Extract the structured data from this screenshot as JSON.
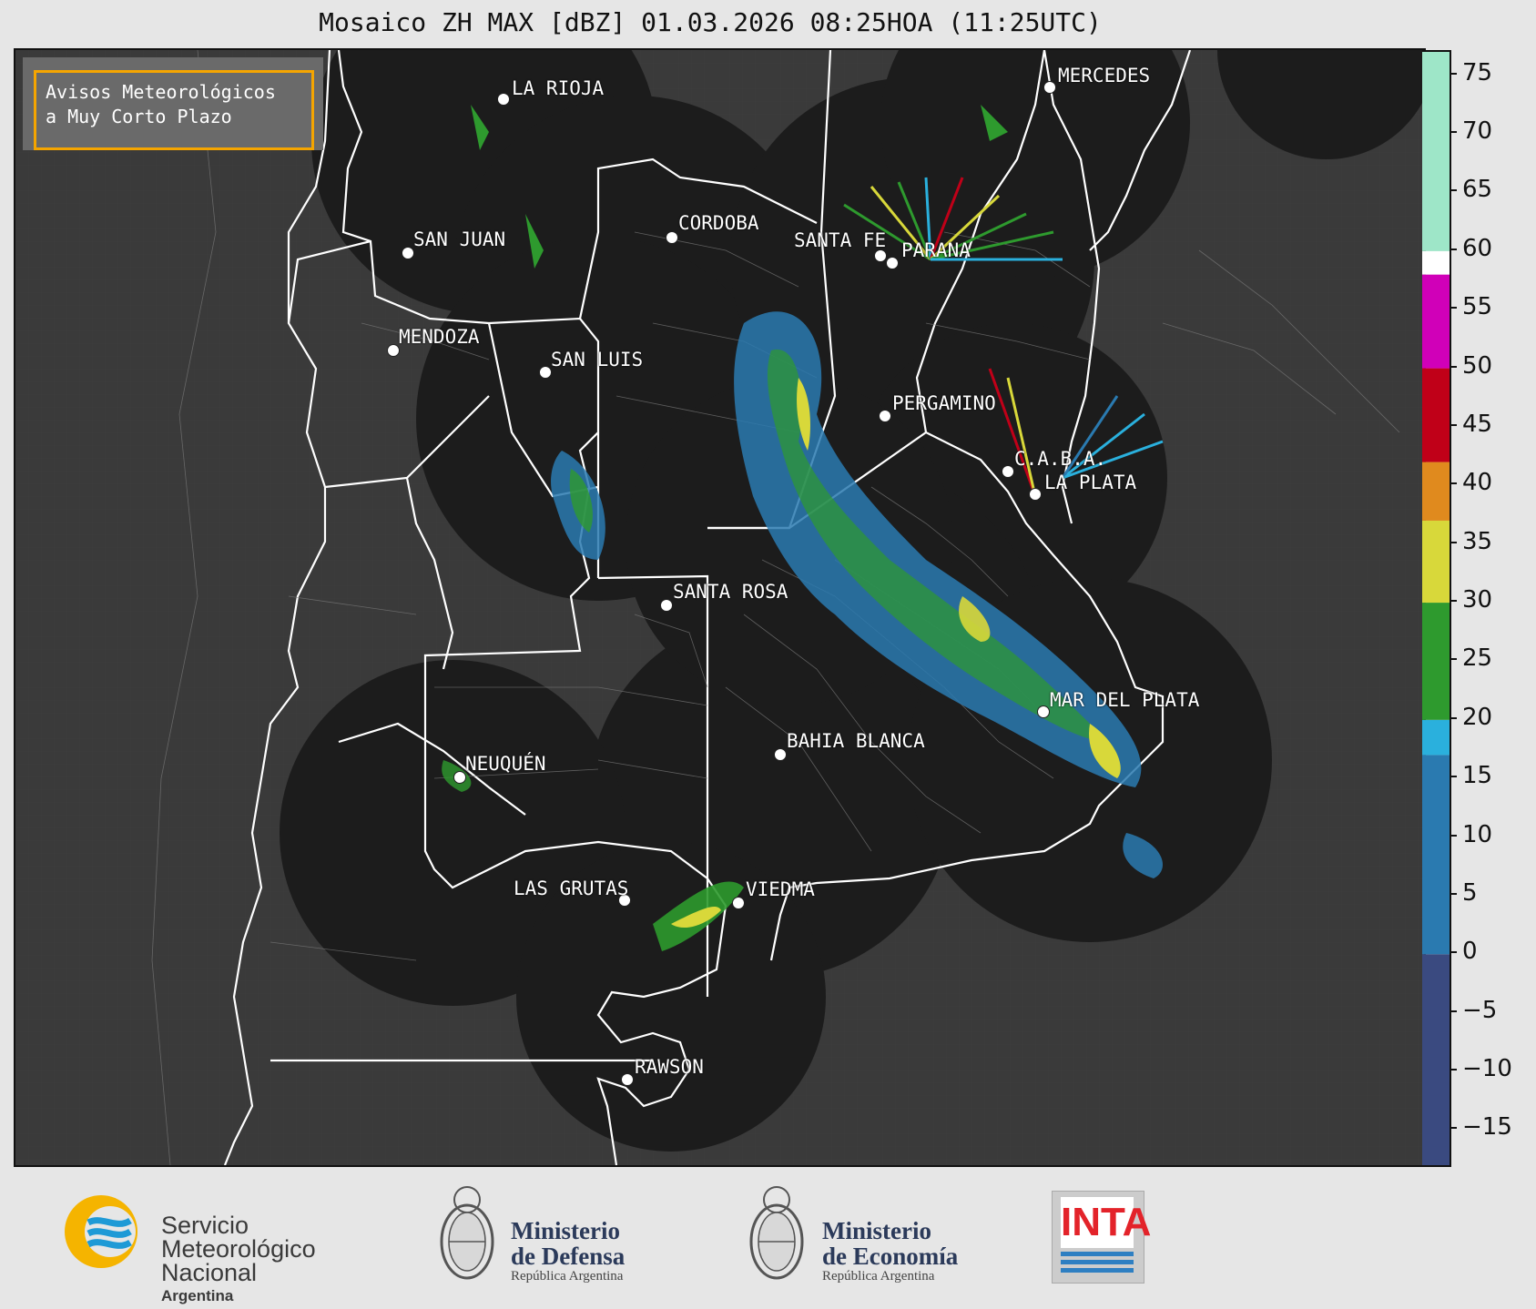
{
  "title": "Mosaico ZH MAX [dBZ] 01.03.2026 08:25HOA (11:25UTC)",
  "avisos": {
    "line1": "Avisos Meteorológicos",
    "line2": "a Muy Corto Plazo"
  },
  "cities": [
    {
      "name": "LA RIOJA"
    },
    {
      "name": "MERCEDES"
    },
    {
      "name": "SAN JUAN"
    },
    {
      "name": "CORDOBA"
    },
    {
      "name": "SANTA FE"
    },
    {
      "name": "PARANA"
    },
    {
      "name": "MENDOZA"
    },
    {
      "name": "SAN LUIS"
    },
    {
      "name": "PERGAMINO"
    },
    {
      "name": "C.A.B.A."
    },
    {
      "name": "LA PLATA"
    },
    {
      "name": "SANTA ROSA"
    },
    {
      "name": "MAR DEL PLATA"
    },
    {
      "name": "BAHIA BLANCA"
    },
    {
      "name": "NEUQUÉN"
    },
    {
      "name": "LAS GRUTAS"
    },
    {
      "name": "VIEDMA"
    },
    {
      "name": "RAWSON"
    }
  ],
  "colorbar": {
    "min": -18,
    "max": 77,
    "ticks": [
      "75",
      "70",
      "65",
      "60",
      "55",
      "50",
      "45",
      "40",
      "35",
      "30",
      "25",
      "20",
      "15",
      "10",
      "5",
      "0",
      "−5",
      "−10",
      "−15"
    ],
    "tick_values": [
      75,
      70,
      65,
      60,
      55,
      50,
      45,
      40,
      35,
      30,
      25,
      20,
      15,
      10,
      5,
      0,
      -5,
      -10,
      -15
    ],
    "stops": [
      {
        "from": -18,
        "to": 0,
        "color": "#3a4a80"
      },
      {
        "from": 0,
        "to": 17,
        "color": "#2a7ab0"
      },
      {
        "from": 17,
        "to": 20,
        "color": "#2ab0dd"
      },
      {
        "from": 20,
        "to": 30,
        "color": "#2e9a2e"
      },
      {
        "from": 30,
        "to": 37,
        "color": "#d8d83a"
      },
      {
        "from": 37,
        "to": 42,
        "color": "#e08a1e"
      },
      {
        "from": 42,
        "to": 50,
        "color": "#c00018"
      },
      {
        "from": 50,
        "to": 58,
        "color": "#d000b8"
      },
      {
        "from": 58,
        "to": 60,
        "color": "#ffffff"
      },
      {
        "from": 60,
        "to": 77,
        "color": "#9ee6c8"
      }
    ]
  },
  "logos": {
    "smn": {
      "line1": "Servicio",
      "line2": "Meteorológico",
      "line3": "Nacional",
      "line4": "Argentina"
    },
    "defensa": {
      "line1": "Ministerio",
      "line2": "de Defensa",
      "line3": "República Argentina"
    },
    "economia": {
      "line1": "Ministerio",
      "line2": "de Economía",
      "line3": "República Argentina"
    },
    "inta": {
      "text": "INTA"
    }
  }
}
